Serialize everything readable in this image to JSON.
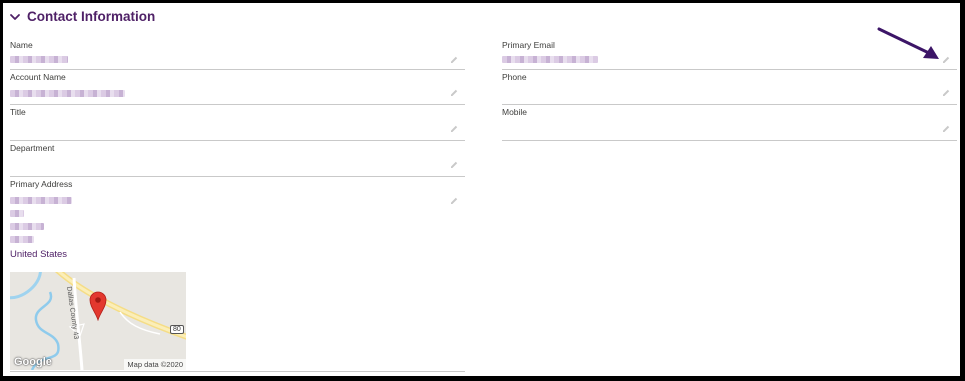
{
  "section": {
    "title": "Contact Information"
  },
  "left_fields": {
    "name": {
      "label": "Name"
    },
    "account_name": {
      "label": "Account Name"
    },
    "title": {
      "label": "Title"
    },
    "department": {
      "label": "Department"
    },
    "primary_address": {
      "label": "Primary Address",
      "country": "United States"
    }
  },
  "right_fields": {
    "primary_email": {
      "label": "Primary Email"
    },
    "phone": {
      "label": "Phone"
    },
    "mobile": {
      "label": "Mobile"
    }
  },
  "map": {
    "road_label": "Dallas County 43",
    "route_shield": "80",
    "brand": "Google",
    "credit": "Map data ©2020"
  },
  "colors": {
    "accent": "#4f2167",
    "arrow": "#3c1567",
    "pin": "#e3382e"
  },
  "icons": {
    "collapse": "chevron-down-icon",
    "edit": "pencil-icon",
    "pin": "map-pin-icon"
  }
}
